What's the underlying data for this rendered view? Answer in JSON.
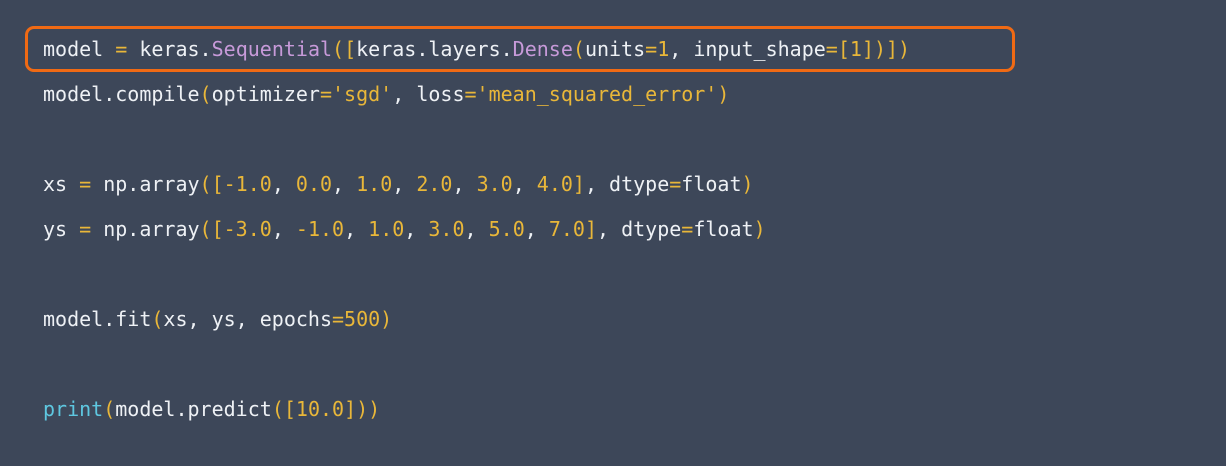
{
  "colors": {
    "background": "#3d4759",
    "highlight_border": "#f06a14",
    "identifier": "#eef1f5",
    "function_name": "#c79ad9",
    "builtin": "#5ec7e0",
    "literal": "#e9b739"
  },
  "code": {
    "lines": [
      {
        "tokens": [
          {
            "t": "model",
            "k": "id"
          },
          {
            "t": " ",
            "k": "id"
          },
          {
            "t": "=",
            "k": "op"
          },
          {
            "t": " keras.",
            "k": "id"
          },
          {
            "t": "Sequential",
            "k": "fn"
          },
          {
            "t": "([",
            "k": "paren"
          },
          {
            "t": "keras.layers.",
            "k": "id"
          },
          {
            "t": "Dense",
            "k": "fn"
          },
          {
            "t": "(",
            "k": "paren"
          },
          {
            "t": "units",
            "k": "id"
          },
          {
            "t": "=",
            "k": "op"
          },
          {
            "t": "1",
            "k": "num"
          },
          {
            "t": ", input_shape",
            "k": "id"
          },
          {
            "t": "=",
            "k": "op"
          },
          {
            "t": "[",
            "k": "paren"
          },
          {
            "t": "1",
            "k": "num"
          },
          {
            "t": "])])",
            "k": "paren"
          }
        ]
      },
      {
        "tokens": [
          {
            "t": "model.compile",
            "k": "id"
          },
          {
            "t": "(",
            "k": "paren"
          },
          {
            "t": "optimizer",
            "k": "id"
          },
          {
            "t": "=",
            "k": "op"
          },
          {
            "t": "'sgd'",
            "k": "str"
          },
          {
            "t": ", loss",
            "k": "id"
          },
          {
            "t": "=",
            "k": "op"
          },
          {
            "t": "'mean_squared_error'",
            "k": "str"
          },
          {
            "t": ")",
            "k": "paren"
          }
        ]
      },
      {
        "tokens": [
          {
            "t": "xs ",
            "k": "id"
          },
          {
            "t": "=",
            "k": "op"
          },
          {
            "t": " np.array",
            "k": "id"
          },
          {
            "t": "([",
            "k": "paren"
          },
          {
            "t": "-1.0",
            "k": "num"
          },
          {
            "t": ", ",
            "k": "id"
          },
          {
            "t": "0.0",
            "k": "num"
          },
          {
            "t": ", ",
            "k": "id"
          },
          {
            "t": "1.0",
            "k": "num"
          },
          {
            "t": ", ",
            "k": "id"
          },
          {
            "t": "2.0",
            "k": "num"
          },
          {
            "t": ", ",
            "k": "id"
          },
          {
            "t": "3.0",
            "k": "num"
          },
          {
            "t": ", ",
            "k": "id"
          },
          {
            "t": "4.0",
            "k": "num"
          },
          {
            "t": "]",
            "k": "paren"
          },
          {
            "t": ", dtype",
            "k": "id"
          },
          {
            "t": "=",
            "k": "op"
          },
          {
            "t": "float",
            "k": "id"
          },
          {
            "t": ")",
            "k": "paren"
          }
        ]
      },
      {
        "tokens": [
          {
            "t": "ys ",
            "k": "id"
          },
          {
            "t": "=",
            "k": "op"
          },
          {
            "t": " np.array",
            "k": "id"
          },
          {
            "t": "([",
            "k": "paren"
          },
          {
            "t": "-3.0",
            "k": "num"
          },
          {
            "t": ", ",
            "k": "id"
          },
          {
            "t": "-1.0",
            "k": "num"
          },
          {
            "t": ", ",
            "k": "id"
          },
          {
            "t": "1.0",
            "k": "num"
          },
          {
            "t": ", ",
            "k": "id"
          },
          {
            "t": "3.0",
            "k": "num"
          },
          {
            "t": ", ",
            "k": "id"
          },
          {
            "t": "5.0",
            "k": "num"
          },
          {
            "t": ", ",
            "k": "id"
          },
          {
            "t": "7.0",
            "k": "num"
          },
          {
            "t": "]",
            "k": "paren"
          },
          {
            "t": ", dtype",
            "k": "id"
          },
          {
            "t": "=",
            "k": "op"
          },
          {
            "t": "float",
            "k": "id"
          },
          {
            "t": ")",
            "k": "paren"
          }
        ]
      },
      {
        "tokens": [
          {
            "t": "model.fit",
            "k": "id"
          },
          {
            "t": "(",
            "k": "paren"
          },
          {
            "t": "xs, ys, epochs",
            "k": "id"
          },
          {
            "t": "=",
            "k": "op"
          },
          {
            "t": "500",
            "k": "num"
          },
          {
            "t": ")",
            "k": "paren"
          }
        ]
      },
      {
        "tokens": [
          {
            "t": "print",
            "k": "builtin"
          },
          {
            "t": "(",
            "k": "paren"
          },
          {
            "t": "model.predict",
            "k": "id"
          },
          {
            "t": "([",
            "k": "paren"
          },
          {
            "t": "10.0",
            "k": "num"
          },
          {
            "t": "]))",
            "k": "paren"
          }
        ]
      }
    ]
  }
}
